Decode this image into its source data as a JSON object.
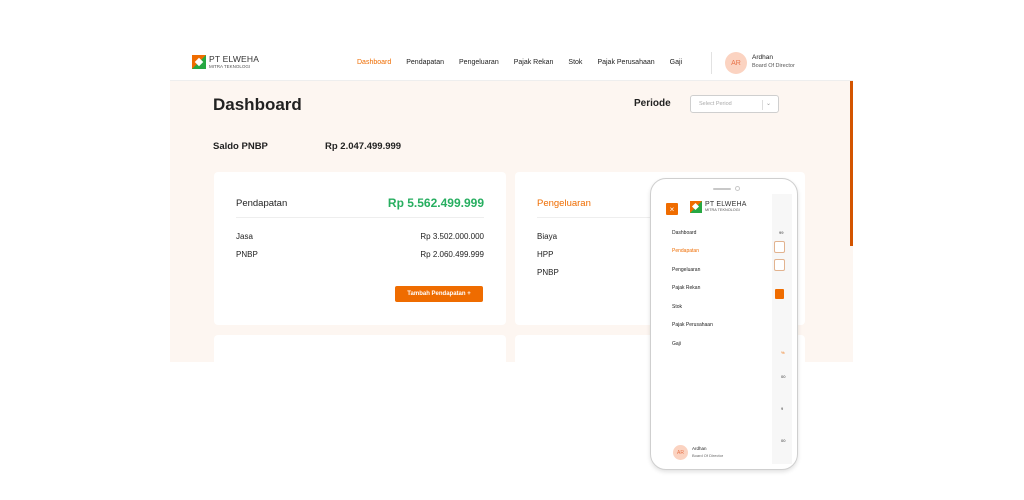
{
  "brand": {
    "name": "PT ELWEHA",
    "subtitle": "MITRA TEKNOLOGI"
  },
  "nav": {
    "items": [
      "Dashboard",
      "Pendapatan",
      "Pengeluaran",
      "Pajak Rekan",
      "Stok",
      "Pajak Perusahaan",
      "Gaji"
    ],
    "active": "Dashboard"
  },
  "user": {
    "initials": "AR",
    "name": "Ardhan",
    "role": "Board Of Director"
  },
  "page": {
    "title": "Dashboard",
    "periode_label": "Periode",
    "period_placeholder": "Select Period"
  },
  "saldo": {
    "label": "Saldo PNBP",
    "value": "Rp 2.047.499.999"
  },
  "pendapatan_card": {
    "title": "Pendapatan",
    "total": "Rp 5.562.499.999",
    "rows": [
      {
        "label": "Jasa",
        "value": "Rp 3.502.000.000"
      },
      {
        "label": "PNBP",
        "value": "Rp 2.060.499.999"
      }
    ],
    "button": "Tambah Pendapatan +"
  },
  "pengeluaran_card": {
    "title": "Pengeluaran",
    "rows": [
      "Biaya",
      "HPP",
      "PNBP"
    ]
  },
  "mobile": {
    "close": "×",
    "menu": [
      "Dashboard",
      "Pendapatan",
      "Pengeluaran",
      "Pajak Rekan",
      "Stok",
      "Pajak Perusahaan",
      "Gaji"
    ],
    "active": "Pendapatan",
    "bg_fragments": [
      "99",
      "%",
      "00",
      "9",
      "00"
    ]
  },
  "colors": {
    "accent": "#ef6c00",
    "positive": "#27ae60",
    "background": "#fdf6f1"
  }
}
